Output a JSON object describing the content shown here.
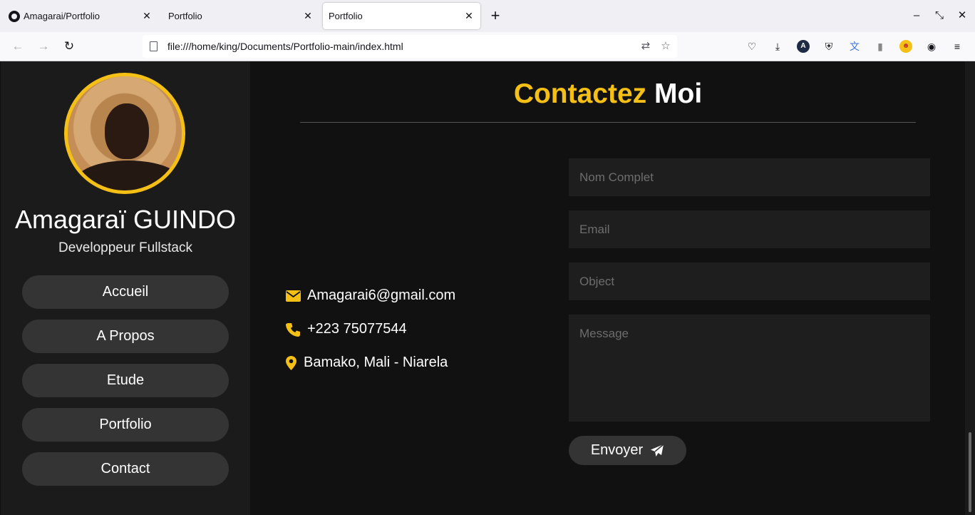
{
  "browser": {
    "tabs": [
      {
        "label": "Amagarai/Portfolio",
        "icon": "github-icon"
      },
      {
        "label": "Portfolio"
      },
      {
        "label": "Portfolio",
        "active": true
      }
    ],
    "url": "file:///home/king/Documents/Portfolio-main/index.html"
  },
  "sidebar": {
    "name": "Amagaraï GUINDO",
    "role": "Developpeur Fullstack",
    "menu": [
      {
        "label": "Accueil"
      },
      {
        "label": "A Propos"
      },
      {
        "label": "Etude"
      },
      {
        "label": "Portfolio"
      },
      {
        "label": "Contact"
      }
    ]
  },
  "contact": {
    "title_accent": "Contactez",
    "title_rest": "Moi",
    "email": "Amagarai6@gmail.com",
    "phone": "+223 75077544",
    "address": "Bamako, Mali - Niarela",
    "form": {
      "name_placeholder": "Nom Complet",
      "email_placeholder": "Email",
      "object_placeholder": "Object",
      "message_placeholder": "Message",
      "submit_label": "Envoyer"
    }
  },
  "colors": {
    "accent": "#f5c016",
    "background": "#111111",
    "sidebar": "#1b1b1b",
    "button": "#343434"
  }
}
